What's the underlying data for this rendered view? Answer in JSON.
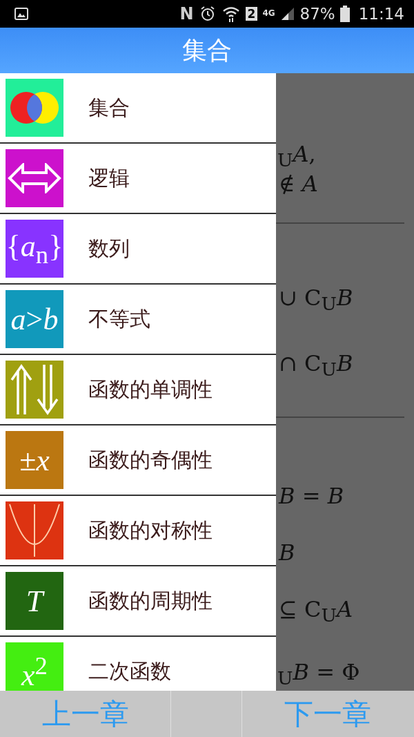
{
  "status_bar": {
    "nfc": "N",
    "sim": "2",
    "network": "4G",
    "battery": "87%",
    "time": "11:14"
  },
  "title_bar": {
    "title": "集合"
  },
  "background": {
    "sections": [
      [
        "$_{U}$*A*,",
        "∉ *A*"
      ],
      [
        "∪ C$_{U}$*B*",
        "∩ C$_{U}$*B*"
      ],
      [
        "*B* = *B*",
        "*B*",
        "⊆ C$_{U}$*A*",
        "$_{U}$*B* = Φ"
      ]
    ]
  },
  "drawer": {
    "items": [
      {
        "label": "集合",
        "kind": "venn",
        "color": "#22ee99",
        "selected": false
      },
      {
        "label": "逻辑",
        "kind": "double-arrow",
        "color": "#cc11cc",
        "selected": false
      },
      {
        "label": "数列",
        "kind": "text",
        "icon_text": "{*a*$_{n}$}",
        "color": "#8833ff",
        "selected": false
      },
      {
        "label": "不等式",
        "kind": "text",
        "icon_text": "*a*>*b*",
        "color": "#1199bb",
        "selected": false
      },
      {
        "label": "函数的单调性",
        "kind": "updown-arrows",
        "color": "#a0a010",
        "selected": false
      },
      {
        "label": "函数的奇偶性",
        "kind": "text",
        "icon_text": "±*x*",
        "color": "#bb7711",
        "selected": false
      },
      {
        "label": "函数的对称性",
        "kind": "parabola",
        "color": "#dd3311",
        "selected": false
      },
      {
        "label": "函数的周期性",
        "kind": "text",
        "icon_text": "*T*",
        "color": "#226611",
        "selected": false
      },
      {
        "label": "二次函数",
        "kind": "text",
        "icon_text": "*x*$^{2}$",
        "color": "#44ee11",
        "selected": false
      }
    ]
  },
  "bottom_bar": {
    "buttons": [
      "上一章",
      "下一章"
    ]
  }
}
